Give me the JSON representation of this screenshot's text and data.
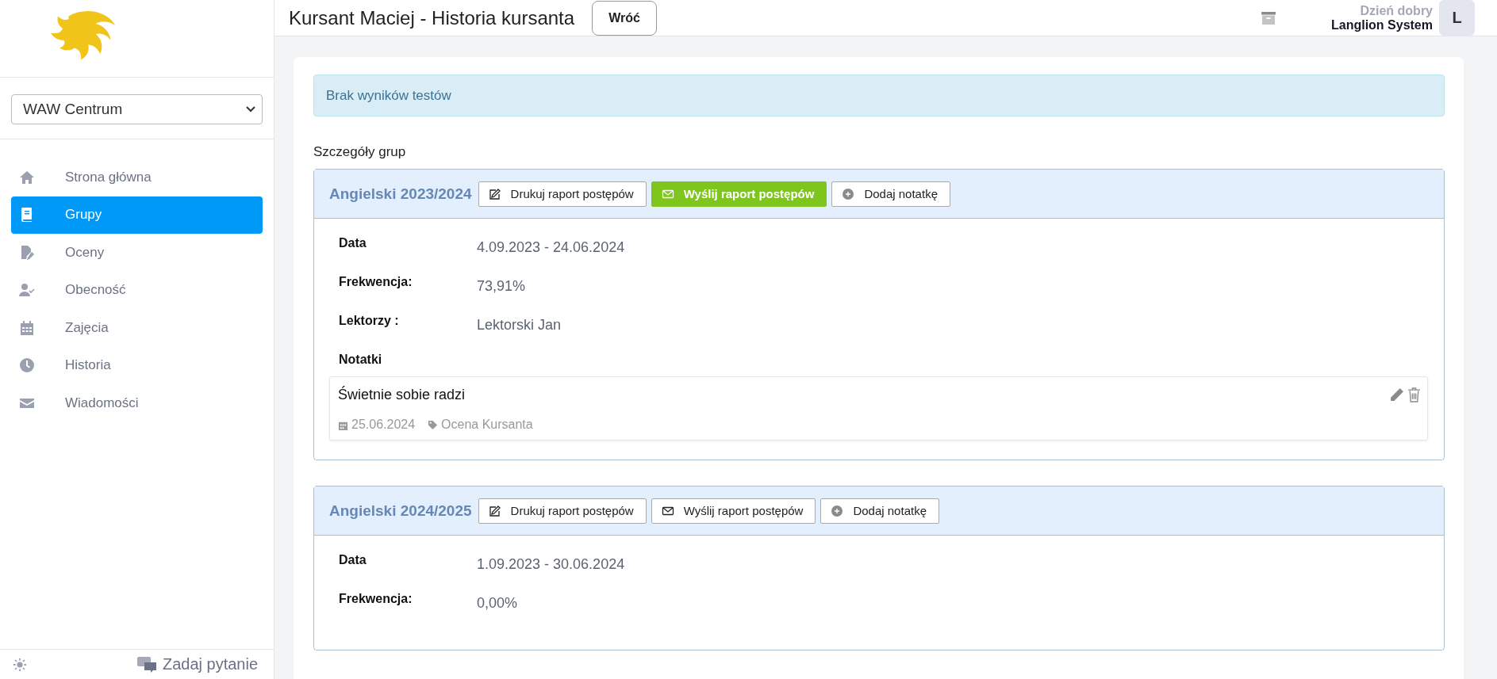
{
  "sidebar": {
    "branch_select": {
      "value": "WAW Centrum"
    },
    "items": [
      {
        "kind": "home",
        "label": "Strona główna",
        "selected": false
      },
      {
        "kind": "book",
        "label": "Grupy",
        "selected": true
      },
      {
        "kind": "grades",
        "label": "Oceny",
        "selected": false
      },
      {
        "kind": "attendance",
        "label": "Obecność",
        "selected": false
      },
      {
        "kind": "calendar",
        "label": "Zajęcia",
        "selected": false
      },
      {
        "kind": "clock",
        "label": "Historia",
        "selected": false
      },
      {
        "kind": "mail",
        "label": "Wiadomości",
        "selected": false
      }
    ],
    "help_link": "Zadaj pytanie"
  },
  "header": {
    "title": "Kursant Maciej - Historia kursanta",
    "back_button": "Wróć",
    "greeting": "Dzień dobry",
    "user_name": "Langlion System",
    "avatar_letter": "L"
  },
  "alert": "Brak wyników testów",
  "section_title": "Szczegóły grup",
  "groups": [
    {
      "name": "Angielski 2023/2024",
      "buttons": [
        {
          "kind": "print",
          "label": "Drukuj raport postępów",
          "highlighted": false
        },
        {
          "kind": "send",
          "label": "Wyślij raport postępów",
          "highlighted": true
        },
        {
          "kind": "note",
          "label": "Dodaj notatkę",
          "highlighted": false
        }
      ],
      "details": [
        {
          "label": "Data",
          "value": "4.09.2023 - 24.06.2024"
        },
        {
          "label": "Frekwencja:",
          "value": "73,91%"
        },
        {
          "label": "Lektorzy :",
          "value": "Lektorski Jan"
        }
      ],
      "notes_label": "Notatki",
      "notes": [
        {
          "text": "Świetnie sobie radzi",
          "date": "25.06.2024",
          "tag": "Ocena Kursanta"
        }
      ]
    },
    {
      "name": "Angielski 2024/2025",
      "buttons": [
        {
          "kind": "print",
          "label": "Drukuj raport postępów",
          "highlighted": false
        },
        {
          "kind": "send",
          "label": "Wyślij raport postępów",
          "highlighted": false
        },
        {
          "kind": "note",
          "label": "Dodaj notatkę",
          "highlighted": false
        }
      ],
      "details": [
        {
          "label": "Data",
          "value": "1.09.2023 - 30.06.2024"
        },
        {
          "label": "Frekwencja:",
          "value": "0,00%"
        }
      ]
    }
  ]
}
